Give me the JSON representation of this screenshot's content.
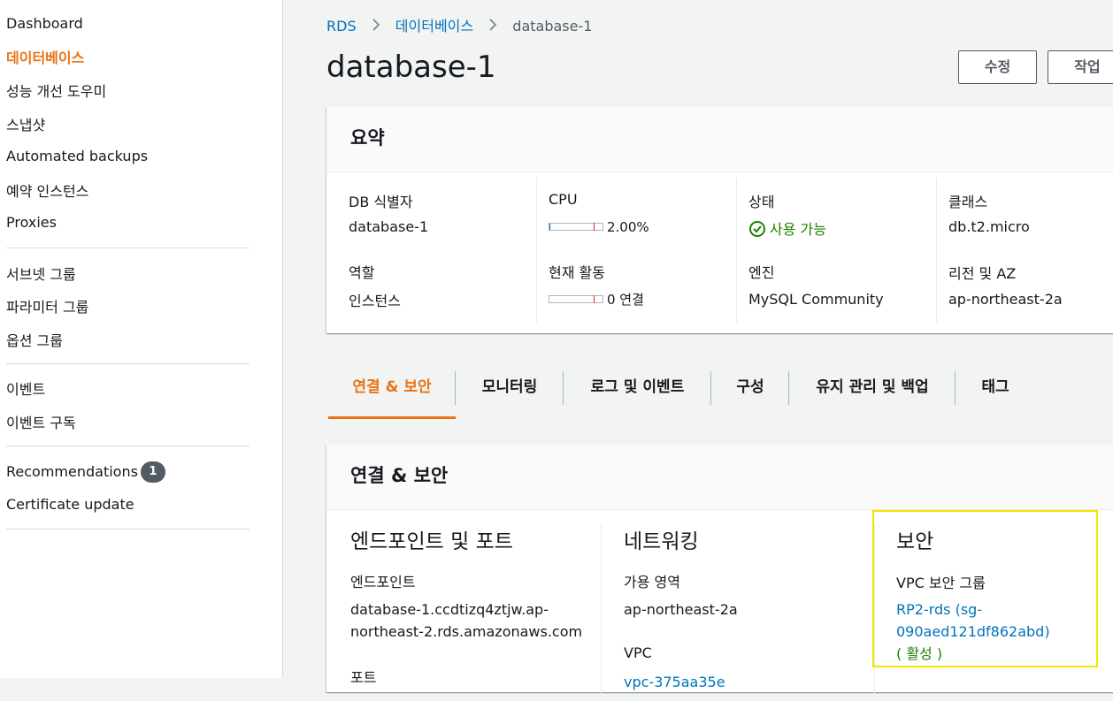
{
  "sidebar": {
    "items": [
      {
        "label": "Dashboard"
      },
      {
        "label": "데이터베이스",
        "active": true
      },
      {
        "label": "성능 개선 도우미"
      },
      {
        "label": "스냅샷"
      },
      {
        "label": "Automated backups"
      },
      {
        "label": "예약 인스턴스"
      },
      {
        "label": "Proxies"
      },
      {
        "label": "서브넷 그룹"
      },
      {
        "label": "파라미터 그룹"
      },
      {
        "label": "옵션 그룹"
      },
      {
        "label": "이벤트"
      },
      {
        "label": "이벤트 구독"
      },
      {
        "label": "Recommendations",
        "badge": "1"
      },
      {
        "label": "Certificate update"
      }
    ]
  },
  "breadcrumb": {
    "root": "RDS",
    "section": "데이터베이스",
    "current": "database-1"
  },
  "page_title": "database-1",
  "actions": {
    "modify": "수정",
    "actions": "작업"
  },
  "summary": {
    "title": "요약",
    "db_identifier_label": "DB 식별자",
    "db_identifier_value": "database-1",
    "role_label": "역할",
    "role_value": "인스턴스",
    "cpu_label": "CPU",
    "cpu_value": "2.00%",
    "cpu_fraction": 0.02,
    "activity_label": "현재 활동",
    "activity_value": "0 연결",
    "status_label": "상태",
    "status_value": "사용 가능",
    "engine_label": "엔진",
    "engine_value": "MySQL Community",
    "class_label": "클래스",
    "class_value": "db.t2.micro",
    "region_label": "리전 및 AZ",
    "region_value": "ap-northeast-2a"
  },
  "tabs": [
    {
      "label": "연결 & 보안",
      "active": true
    },
    {
      "label": "모니터링"
    },
    {
      "label": "로그 및 이벤트"
    },
    {
      "label": "구성"
    },
    {
      "label": "유지 관리 및 백업"
    },
    {
      "label": "태그"
    }
  ],
  "connectivity": {
    "title": "연결 & 보안",
    "endpoint_section": "엔드포인트 및 포트",
    "endpoint_label": "엔드포인트",
    "endpoint_line1": "database-1.ccdtizq4ztjw.ap-",
    "endpoint_line2": "northeast-2.rds.amazonaws.com",
    "port_label": "포트",
    "network_section": "네트워킹",
    "az_label": "가용 영역",
    "az_value": "ap-northeast-2a",
    "vpc_label": "VPC",
    "vpc_value": "vpc-375aa35e",
    "security_section": "보안",
    "sg_label": "VPC 보안 그룹",
    "sg_line1": "RP2-rds (sg-",
    "sg_line2": "090aed121df862abd)",
    "sg_status": "( 활성 )"
  },
  "colors": {
    "accent": "#ec7211",
    "link": "#0073bb",
    "success": "#1d8102",
    "highlight": "#f2e600"
  }
}
